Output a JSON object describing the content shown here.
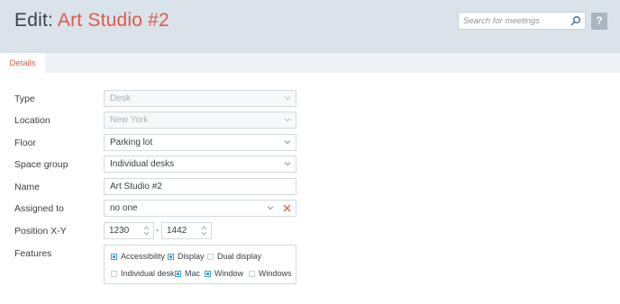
{
  "header": {
    "title_prefix": "Edit: ",
    "title_name": "Art Studio #2",
    "search_placeholder": "Search for meetings",
    "help_label": "?"
  },
  "tabs": [
    {
      "label": "Details",
      "active": true
    }
  ],
  "form": {
    "type": {
      "label": "Type",
      "value": "Desk"
    },
    "location": {
      "label": "Location",
      "value": "New York"
    },
    "floor": {
      "label": "Floor",
      "value": "Parking lot"
    },
    "space_group": {
      "label": "Space group",
      "value": "Individual desks"
    },
    "name": {
      "label": "Name",
      "value": "Art Studio #2"
    },
    "assigned_to": {
      "label": "Assigned to",
      "value": "no one"
    },
    "position": {
      "label": "Position X-Y",
      "x": "1230",
      "separator": "-",
      "y": "1442"
    },
    "features": {
      "label": "Features",
      "items": [
        {
          "label": "Accessibility",
          "checked": true
        },
        {
          "label": "Display",
          "checked": true
        },
        {
          "label": "Dual display",
          "checked": false
        },
        {
          "label": "Individual desk",
          "checked": false
        },
        {
          "label": "Mac",
          "checked": true
        },
        {
          "label": "Window",
          "checked": true
        },
        {
          "label": "Windows",
          "checked": false
        }
      ]
    }
  },
  "colors": {
    "accent": "#e05a4a",
    "header_bg": "#d9e3e9",
    "checkbox_on": "#3d9fd0"
  },
  "icons": {
    "search": "search-icon",
    "dropdown": "chevron-down-icon",
    "clear": "close-icon",
    "stepper": "stepper-icon"
  }
}
